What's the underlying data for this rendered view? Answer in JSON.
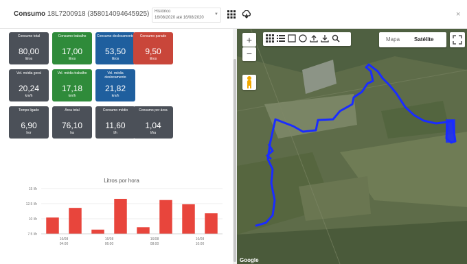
{
  "header": {
    "title": "Consumo",
    "device": "18L7200918 (358014094645925)",
    "history_label": "Histórico",
    "history_range": "16/08/2020 até 16/08/2020",
    "close_label": "×"
  },
  "tiles": [
    {
      "label": "Consumo total",
      "value": "80,00",
      "unit": "litros",
      "color": "#4b5058"
    },
    {
      "label": "Consumo trabalho",
      "value": "17,00",
      "unit": "litros",
      "color": "#2f8b3a"
    },
    {
      "label": "Consumo deslocamento",
      "value": "53,50",
      "unit": "litros",
      "color": "#1f5f9e"
    },
    {
      "label": "Consumo parado",
      "value": "9,50",
      "unit": "litros",
      "color": "#c9463a"
    },
    {
      "label": "Vel. média geral",
      "value": "20,24",
      "unit": "km/h",
      "color": "#4b5058"
    },
    {
      "label": "Vel. média trabalho",
      "value": "17,18",
      "unit": "km/h",
      "color": "#2f8b3a"
    },
    {
      "label": "Vel. média deslocamento",
      "value": "21,82",
      "unit": "km/h",
      "color": "#1f5f9e"
    },
    {
      "label": "Tempo ligado",
      "value": "6,90",
      "unit": "hor",
      "color": "#4b5058"
    },
    {
      "label": "Área total",
      "value": "76,10",
      "unit": "ha",
      "color": "#4b5058"
    },
    {
      "label": "Consumo médio",
      "value": "11,60",
      "unit": "l/h",
      "color": "#4b5058"
    },
    {
      "label": "Consumo por área",
      "value": "1,04",
      "unit": "l/ha",
      "color": "#4b5058"
    }
  ],
  "chart_data": {
    "type": "bar",
    "title": "Litros por hora",
    "yticks": [
      "15 l/h",
      "12.5 l/h",
      "10 l/h",
      "7.5 l/h"
    ],
    "ylim": [
      7.5,
      15
    ],
    "values": [
      10.2,
      11.8,
      8.2,
      13.3,
      8.6,
      13.1,
      12.4,
      10.9
    ],
    "xtick_labels": [
      {
        "line1": "16/08",
        "line2": "04:00"
      },
      {
        "line1": "16/08",
        "line2": "06:00"
      },
      {
        "line1": "16/08",
        "line2": "08:00"
      },
      {
        "line1": "16/08",
        "line2": "10:00"
      }
    ],
    "bar_color": "#e8453c",
    "grid": true
  },
  "map": {
    "zoom_in": "+",
    "zoom_out": "−",
    "type_map": "Mapa",
    "type_satellite": "Satélite",
    "attribution": "Google",
    "route_color": "#1a2cff"
  }
}
